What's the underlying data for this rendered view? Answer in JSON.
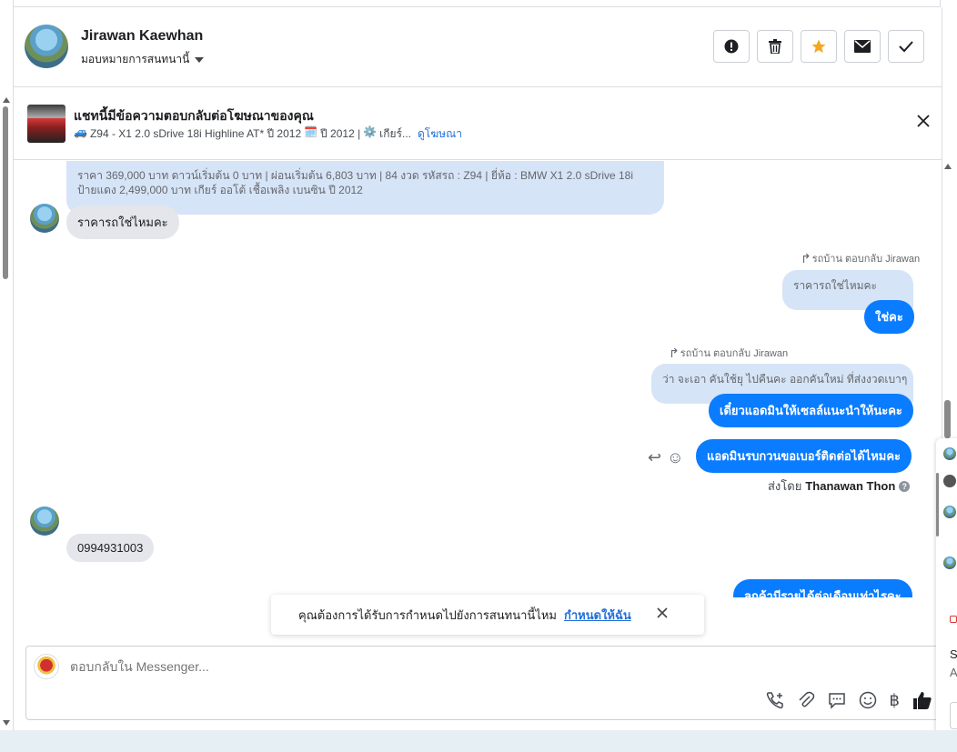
{
  "header": {
    "name": "Jirawan Kaewhan",
    "assign_label": "มอบหมายการสนทนานี้",
    "actions": [
      "spam-button",
      "delete-button",
      "star-button",
      "mail-button",
      "done-button"
    ]
  },
  "ad": {
    "title": "แชทนี้มีข้อความตอบกลับต่อโฆษณาของคุณ",
    "car_emoji": "🚙",
    "model": "Z94 - X1 2.0 sDrive 18i Highline AT* ปี 2012",
    "cal_emoji": "🗓️",
    "year": "ปี 2012 |",
    "gear_emoji": "⚙️",
    "gear": "เกียร์...",
    "link": "ดูโฆษณา"
  },
  "messages": {
    "quote1": "ราคา 369,000 บาท ดาวน์เริ่มต้น 0 บาท | ผ่อนเริ่มต้น 6,803 บาท | 84 งวด รหัสรถ : Z94 | ยี่ห้อ : BMW X1 2.0 sDrive 18i ป้ายแดง 2,499,000 บาท เกียร์ ออโต้ เชื้อเพลิง เบนซิน ปี 2012",
    "in1": "ราคารถใช่ไหมคะ",
    "reply_label1": "รถบ้าน ตอบกลับ Jirawan",
    "quote2": "ราคารถใช่ไหมคะ",
    "out1": "ใช่คะ",
    "reply_label2": "รถบ้าน ตอบกลับ Jirawan",
    "quote3": "ว่า จะเอา คันใช้ยุ ไปคืนคะ ออกคันใหม่ ที่ส่งงวดเบาๆ",
    "out2": "เดี๋ยวแอดมินให้เซลล์แนะนำให้นะคะ",
    "out3": "แอดมินรบกวนขอเบอร์ติดต่อได้ไหมคะ",
    "sent_by_prefix": "ส่งโดย",
    "sent_by_name": "Thanawan Thon",
    "in2": "0994931003",
    "out4_partial": "ลูกค้ามีรายได้ต่อเดือนเท่าไรคะ"
  },
  "assign_prompt": {
    "text": "คุณต้องการได้รับการกำหนดไปยังการสนทนานี้ไหม",
    "link": "กำหนดให้ฉัน"
  },
  "composer": {
    "placeholder": "ตอบกลับใน Messenger...",
    "currency": "฿"
  },
  "side_panel": {
    "letter_s": "S",
    "letter_a": "A"
  },
  "colors": {
    "accent": "#0a7cff",
    "link": "#216fdb",
    "star": "#f5a623"
  }
}
